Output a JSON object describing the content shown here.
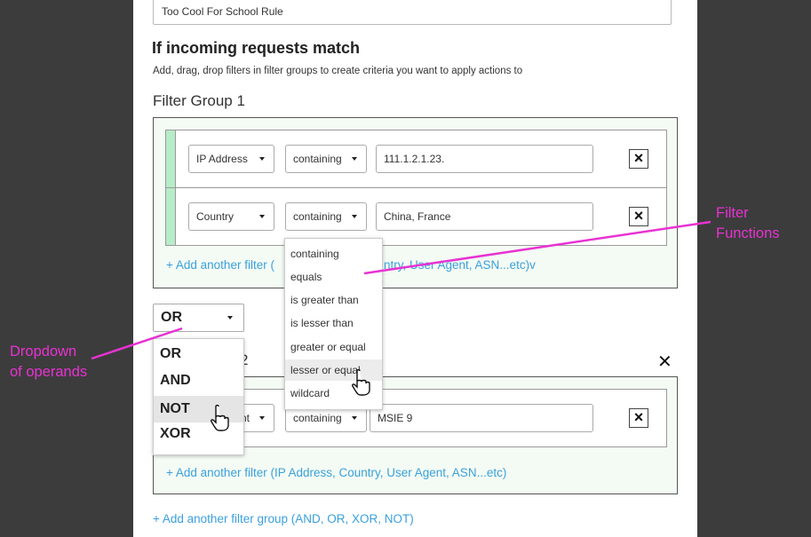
{
  "rule_name": {
    "value": "Too Cool For School Rule"
  },
  "section": {
    "title": "If incoming requests match",
    "subtitle": "Add, drag, drop filters in filter groups to create criteria you want to apply actions to"
  },
  "group1": {
    "title": "Filter Group 1",
    "rows": [
      {
        "field": "IP Address",
        "function": "containing",
        "value": "111.1.2.1.23."
      },
      {
        "field": "Country",
        "function": "containing",
        "value": "China, France"
      }
    ],
    "add_filter_prefix": "+ Add another filter (",
    "add_filter_suffix": "ntry, User Agent, ASN...etc)v"
  },
  "function_dropdown": {
    "items": [
      "containing",
      "equals",
      "is greater than",
      "is lesser than",
      "greater or equal",
      "lesser or equal",
      "wildcard"
    ],
    "highlighted": "lesser or equal"
  },
  "operator": {
    "selected": "OR",
    "options": [
      "OR",
      "AND",
      "NOT",
      "XOR"
    ],
    "highlighted": "NOT"
  },
  "group2": {
    "title_visible": "2",
    "row": {
      "field_partial": "nt",
      "function": "containing",
      "value": "MSIE 9"
    },
    "add_filter": "+ Add another filter (IP Address, Country, User Agent, ASN...etc)"
  },
  "add_group": "+ Add another filter group (AND, OR, XOR, NOT)",
  "annotations": {
    "filter_functions": [
      "Filter",
      "Functions"
    ],
    "dropdown_operands": [
      "Dropdown",
      "of operands"
    ]
  },
  "icons": {
    "close": "close-icon",
    "caret": "caret-down-icon",
    "cursor": "hand-pointer-icon"
  },
  "colors": {
    "annotation": "#e832d2",
    "link": "#3aa0de",
    "stripe": "#b7ecc8",
    "group_bg": "#f4fbf4"
  }
}
